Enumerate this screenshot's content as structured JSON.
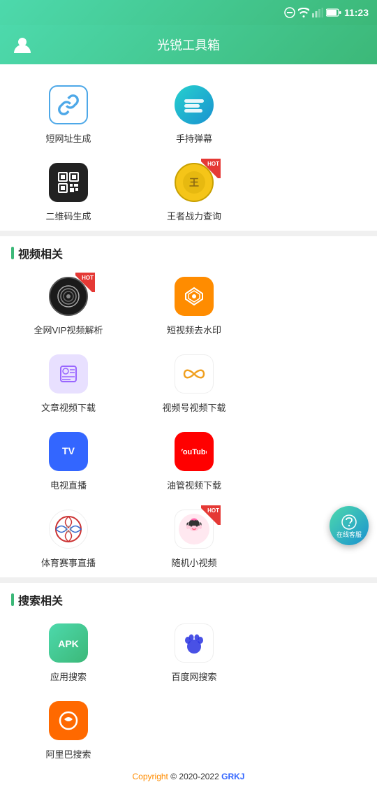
{
  "statusBar": {
    "time": "11:23"
  },
  "header": {
    "title": "光锐工具箱",
    "avatarLabel": "用户头像"
  },
  "topTools": [
    {
      "id": "short-url",
      "label": "短网址生成",
      "icon": "link",
      "hot": false
    },
    {
      "id": "danmu",
      "label": "手持弹幕",
      "icon": "danmu",
      "hot": false
    },
    {
      "id": "qrcode",
      "label": "二维码生成",
      "icon": "qr",
      "hot": false
    },
    {
      "id": "wangzhe",
      "label": "王者战力查询",
      "icon": "wangzhe",
      "hot": true
    }
  ],
  "sections": [
    {
      "id": "video",
      "title": "视频相关",
      "tools": [
        {
          "id": "vip-video",
          "label": "全网VIP视频解析",
          "icon": "vip",
          "hot": true
        },
        {
          "id": "watermark",
          "label": "短视频去水印",
          "icon": "watermark",
          "hot": false
        },
        {
          "id": "article-video",
          "label": "文章视频下载",
          "icon": "article",
          "hot": false
        },
        {
          "id": "video-num",
          "label": "视频号视频下载",
          "icon": "videonum",
          "hot": false
        },
        {
          "id": "tv-live",
          "label": "电视直播",
          "icon": "tv",
          "hot": false
        },
        {
          "id": "youtube",
          "label": "油管视频下载",
          "icon": "youtube",
          "hot": false
        },
        {
          "id": "sports",
          "label": "体育赛事直播",
          "icon": "sports",
          "hot": false
        },
        {
          "id": "random-video",
          "label": "随机小视频",
          "icon": "random",
          "hot": true
        }
      ]
    },
    {
      "id": "search",
      "title": "搜索相关",
      "tools": [
        {
          "id": "apk-search",
          "label": "应用搜索",
          "icon": "apk",
          "hot": false
        },
        {
          "id": "baidu-search",
          "label": "百度网搜索",
          "icon": "baidu",
          "hot": false
        },
        {
          "id": "taobao-search",
          "label": "阿里巴搜索",
          "icon": "taobao",
          "hot": false
        }
      ]
    }
  ],
  "floatService": {
    "label": "在线客服"
  },
  "footer": {
    "copyright": "Copyright",
    "year": " © 2020-2022 ",
    "brand": "GRKJ"
  }
}
